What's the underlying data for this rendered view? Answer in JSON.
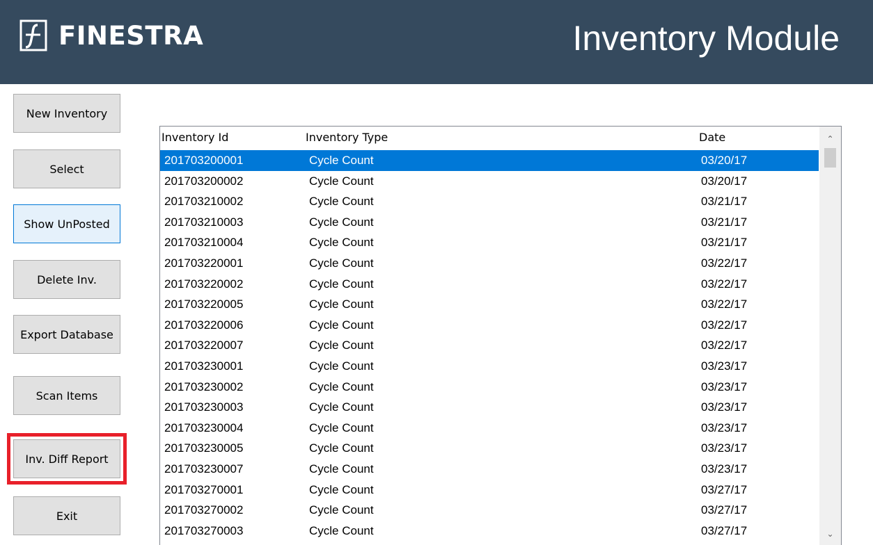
{
  "header": {
    "brand": "FINESTRA",
    "title": "Inventory Module",
    "background": "#354a5e"
  },
  "sidebar": {
    "buttons": [
      {
        "label": "New Inventory"
      },
      {
        "label": "Select"
      },
      {
        "label": "Show UnPosted",
        "state": "focused"
      },
      {
        "label": "Delete Inv."
      },
      {
        "label": "Export Database"
      },
      {
        "label": "Scan Items"
      },
      {
        "label": "Inv. Diff Report",
        "highlighted": true,
        "highlight_color": "#e8202a"
      },
      {
        "label": "Exit"
      }
    ]
  },
  "list": {
    "columns": [
      "Inventory Id",
      "Inventory Type",
      "Date"
    ],
    "selected_index": 0,
    "selection_color": "#0078d7",
    "rows": [
      {
        "id": "201703200001",
        "type": "Cycle Count",
        "date": "03/20/17"
      },
      {
        "id": "201703200002",
        "type": "Cycle Count",
        "date": "03/20/17"
      },
      {
        "id": "201703210002",
        "type": "Cycle Count",
        "date": "03/21/17"
      },
      {
        "id": "201703210003",
        "type": "Cycle Count",
        "date": "03/21/17"
      },
      {
        "id": "201703210004",
        "type": "Cycle Count",
        "date": "03/21/17"
      },
      {
        "id": "201703220001",
        "type": "Cycle Count",
        "date": "03/22/17"
      },
      {
        "id": "201703220002",
        "type": "Cycle Count",
        "date": "03/22/17"
      },
      {
        "id": "201703220005",
        "type": "Cycle Count",
        "date": "03/22/17"
      },
      {
        "id": "201703220006",
        "type": "Cycle Count",
        "date": "03/22/17"
      },
      {
        "id": "201703220007",
        "type": "Cycle Count",
        "date": "03/22/17"
      },
      {
        "id": "201703230001",
        "type": "Cycle Count",
        "date": "03/23/17"
      },
      {
        "id": "201703230002",
        "type": "Cycle Count",
        "date": "03/23/17"
      },
      {
        "id": "201703230003",
        "type": "Cycle Count",
        "date": "03/23/17"
      },
      {
        "id": "201703230004",
        "type": "Cycle Count",
        "date": "03/23/17"
      },
      {
        "id": "201703230005",
        "type": "Cycle Count",
        "date": "03/23/17"
      },
      {
        "id": "201703230007",
        "type": "Cycle Count",
        "date": "03/23/17"
      },
      {
        "id": "201703270001",
        "type": "Cycle Count",
        "date": "03/27/17"
      },
      {
        "id": "201703270002",
        "type": "Cycle Count",
        "date": "03/27/17"
      },
      {
        "id": "201703270003",
        "type": "Cycle Count",
        "date": "03/27/17"
      }
    ]
  },
  "scrollbar": {
    "up_icon": "chevron-up-icon",
    "down_icon": "chevron-down-icon"
  }
}
